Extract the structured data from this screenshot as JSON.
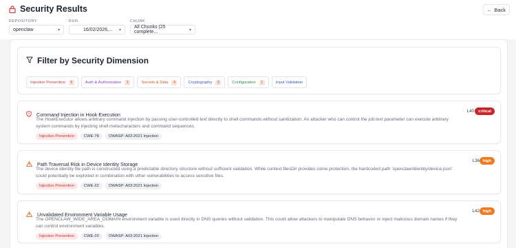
{
  "header": {
    "title": "Security Results",
    "back_label": "Back"
  },
  "filters": {
    "repository": {
      "label": "REPOSITORY",
      "value": "openclaw"
    },
    "run": {
      "label": "RUN",
      "value": "16/02/2026,..."
    },
    "chunk": {
      "label": "CHUNK",
      "value": "All Chunks (25 complete..."
    }
  },
  "dimensions": {
    "title": "Filter by Security Dimension",
    "items": [
      {
        "label": "Injection Prevention",
        "count": "6",
        "color": "#c6373a",
        "bg": "#fce4e3"
      },
      {
        "label": "Auth & Authorization",
        "count": "1",
        "color": "#8a3fb8",
        "bg": "#fbe3d9"
      },
      {
        "label": "Secrets & Data",
        "count": "4",
        "color": "#cc5a1e",
        "bg": "#fde3d6"
      },
      {
        "label": "Cryptography",
        "count": "3",
        "color": "#4455c0",
        "bg": "#fde3d6"
      },
      {
        "label": "Configuration",
        "count": "1",
        "color": "#2e8a4a",
        "bg": "#fde3d6"
      },
      {
        "label": "Input Validation",
        "count": "",
        "color": "#3c5aa8",
        "bg": "#ffffff"
      }
    ]
  },
  "vulnerabilities": [
    {
      "title": "Command Injection in Hook Execution",
      "description": "The HookExecutor allows arbitrary command injection by passing user-controlled text directly to shell commands without sanitization. An attacker who can control the job.text parameter can execute arbitrary system commands by injecting shell metacharacters and command sequences.",
      "line": "L40",
      "severity": "critical",
      "tags": [
        "Injection Prevention",
        "CWE-78",
        "OWASP: A03:2021 Injection"
      ]
    },
    {
      "title": "Path Traversal Risk in Device Identity Storage",
      "description": "The device identity file path is constructed using a predictable directory structure without sufficient validation. While context.filesDir provides some protection, the hardcoded path 'openclaw/identity/device.json' could potentially be exploited in combination with other vulnerabilities to access sensitive files.",
      "line": "L36",
      "severity": "high",
      "tags": [
        "Injection Prevention",
        "CWE-22",
        "OWASP: A03:2021 Injection"
      ]
    },
    {
      "title": "Unvalidated Environment Variable Usage",
      "description": "The OPENCLAW_WIDE_AREA_DOMAIN environment variable is used directly in DNS queries without validation. This could allow attackers to manipulate DNS behavior or inject malicious domain names if they can control environment variables.",
      "line": "L42",
      "severity": "high",
      "tags": [
        "Injection Prevention",
        "CWE-20",
        "OWASP: A03:2021 Injection"
      ]
    }
  ]
}
